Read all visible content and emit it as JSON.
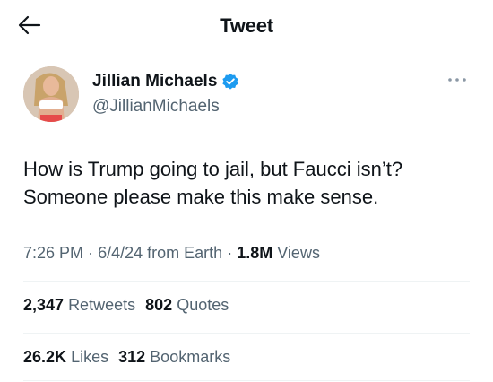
{
  "header": {
    "title": "Tweet"
  },
  "author": {
    "name": "Jillian Michaels",
    "handle": "@JillianMichaels",
    "verified": true
  },
  "tweet": {
    "lines": [
      "How is Trump going to jail, but Faucci isn’t?",
      "Someone please make this make sense."
    ],
    "time": "7:26 PM",
    "date": "6/4/24",
    "source": "from Earth",
    "views_count": "1.8M",
    "views_label": "Views",
    "separator": "·"
  },
  "stats_row1": {
    "retweets_count": "2,347",
    "retweets_label": "Retweets",
    "quotes_count": "802",
    "quotes_label": "Quotes"
  },
  "stats_row2": {
    "likes_count": "26.2K",
    "likes_label": "Likes",
    "bookmarks_count": "312",
    "bookmarks_label": "Bookmarks"
  },
  "colors": {
    "text": "#0f1419",
    "secondary": "#536471",
    "verified": "#1d9bf0",
    "divider": "#eff3f4"
  }
}
